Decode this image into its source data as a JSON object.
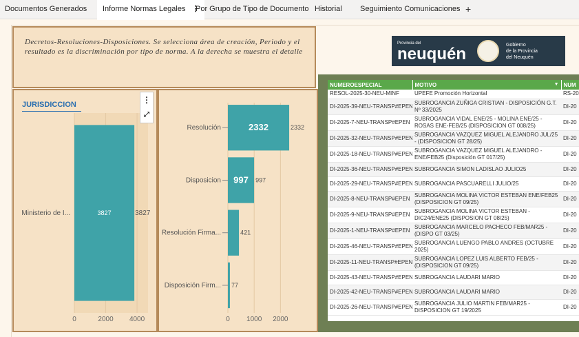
{
  "tabs": [
    {
      "label": "Documentos Generados"
    },
    {
      "label": "Informe Normas Legales",
      "active": true,
      "menu": "⋮"
    },
    {
      "label": "Por Grupo de Tipo de Documento"
    },
    {
      "label": "Historial"
    },
    {
      "label": "Seguimiento Comunicaciones"
    },
    {
      "label": "+"
    }
  ],
  "description": "Decretos-Resoluciones-Disposiciones. Se selecciona área de creación, Periodo y el resultado es la discriminación por tipo de norma. A la derecha se muestra el detalle",
  "logo": {
    "small": "Provincia del",
    "name": "neuquén",
    "gov_line1": "Gobierno",
    "gov_line2": "de la Provincia",
    "gov_line3": "del Neuquén"
  },
  "jurisdiccion": {
    "title": "JURISDICCION",
    "more_icon": "more-options-icon",
    "expand_icon": "expand-icon"
  },
  "colors": {
    "bar": "#3fa3a8",
    "panel": "#f6e2c6",
    "border": "#b58a5a",
    "header": "#5aa84a"
  },
  "chart_data": [
    {
      "type": "bar",
      "orientation": "horizontal",
      "title": "JURISDICCION",
      "categories": [
        "Ministerio de I..."
      ],
      "values": [
        3827
      ],
      "data_labels": [
        "3827"
      ],
      "xticks": [
        "0",
        "2000",
        "4000"
      ],
      "xlim": [
        0,
        4700
      ]
    },
    {
      "type": "bar",
      "orientation": "horizontal",
      "categories": [
        "Resolución",
        "Disposicion",
        "Resolución Firma...",
        "Disposición Firm..."
      ],
      "values": [
        2332,
        997,
        421,
        77
      ],
      "data_labels": [
        "2332",
        "997",
        "421",
        "77"
      ],
      "highlight_labels": [
        "2332",
        "997"
      ],
      "xticks": [
        "0",
        "1000",
        "2000"
      ],
      "xlim": [
        0,
        2750
      ]
    }
  ],
  "table": {
    "columns": [
      "NUMEROESPECIAL",
      "MOTIVO",
      "NUM"
    ],
    "rows": [
      [
        "RESOL-2025-30-NEU-MINF",
        "UPEFE Promoción Horizontal",
        "RS-20"
      ],
      [
        "DI-2025-39-NEU-TRANSP#EPEN",
        "SUBROGANCIA ZUÑIGA CRISTIAN - DISPOSICIÓN G.T. Nº 33/2025",
        "DI-20"
      ],
      [
        "DI-2025-7-NEU-TRANSP#EPEN",
        "SUBROGANCIA VIDAL ENE/25 - MOLINA ENE/25 - ROSAS ENE-FEB/25 (DISPOSICION GT 008/25)",
        "DI-20"
      ],
      [
        "DI-2025-32-NEU-TRANSP#EPEN",
        "SUBROGANCIA VAZQUEZ MIGUEL ALEJANDRO JUL/25 - (DISPOSICION GT 28/25)",
        "DI-20"
      ],
      [
        "DI-2025-18-NEU-TRANSP#EPEN",
        "SUBROGANCIA VAZQUEZ MIGUEL ALEJANDRO - ENE/FEB25 (Disposición GT 017/25)",
        "DI-20"
      ],
      [
        "DI-2025-36-NEU-TRANSP#EPEN",
        "SUBROGANCIA SIMON LADISLAO JULIO25",
        "DI-20"
      ],
      [
        "DI-2025-29-NEU-TRANSP#EPEN",
        "SUBROGANCIA PASCUARELLI JULIO/25",
        "DI-20"
      ],
      [
        "DI-2025-8-NEU-TRANSP#EPEN",
        "SUBROGANCIA MOLINA VICTOR ESTEBAN ENE/FEB25 (DISPOSICION GT 09/25)",
        "DI-20"
      ],
      [
        "DI-2025-9-NEU-TRANSP#EPEN",
        "SUBROGANCIA MOLINA VICTOR ESTEBAN - DIC24/ENE25 (DISPOSION GT 08/25)",
        "DI-20"
      ],
      [
        "DI-2025-1-NEU-TRANSP#EPEN",
        "SUBROGANCIA MARCELO PACHECO FEB/MAR25 - (DISPO GT 03/25)",
        "DI-20"
      ],
      [
        "DI-2025-46-NEU-TRANSP#EPEN",
        "SUBROGANCIA LUENGO PABLO ANDRES (OCTUBRE 2025)",
        "DI-20"
      ],
      [
        "DI-2025-11-NEU-TRANSP#EPEN",
        "SUBROGANCIA LOPEZ LUIS ALBERTO FEB/25 - (DISPOSICION GT 09/25)",
        "DI-20"
      ],
      [
        "DI-2025-43-NEU-TRANSP#EPEN",
        "SUBROGANCIA LAUDARI MARIO",
        "DI-20"
      ],
      [
        "DI-2025-42-NEU-TRANSP#EPEN",
        "SUBROGANCIA LAUDARI MARIO",
        "DI-20"
      ],
      [
        "DI-2025-26-NEU-TRANSP#EPEN",
        "SUBROGANCIA JULIO MARTIN FEB/MAR25 - DISPOSICION GT 19/2025",
        "DI-20"
      ]
    ]
  }
}
